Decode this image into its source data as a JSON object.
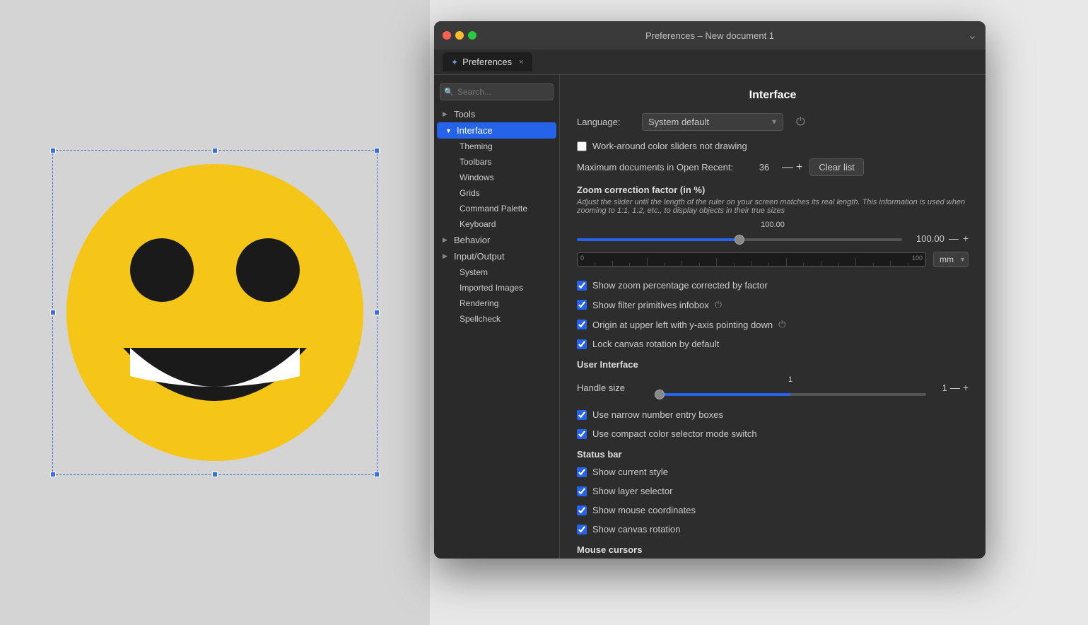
{
  "canvas": {
    "background": "#d4d4d4"
  },
  "window": {
    "title": "Preferences – New document 1",
    "tab_label": "Preferences",
    "tab_close": "×",
    "chevron": "⌄"
  },
  "search": {
    "placeholder": "Search..."
  },
  "sidebar": {
    "items": [
      {
        "id": "tools",
        "label": "Tools",
        "hasArrow": true,
        "arrow": "▶",
        "indent": 0
      },
      {
        "id": "interface",
        "label": "Interface",
        "hasArrow": true,
        "arrow": "▼",
        "indent": 0,
        "active": true
      },
      {
        "id": "theming",
        "label": "Theming",
        "hasArrow": false,
        "arrow": "",
        "indent": 1
      },
      {
        "id": "toolbars",
        "label": "Toolbars",
        "hasArrow": false,
        "arrow": "",
        "indent": 1
      },
      {
        "id": "windows",
        "label": "Windows",
        "hasArrow": false,
        "arrow": "",
        "indent": 1
      },
      {
        "id": "grids",
        "label": "Grids",
        "hasArrow": false,
        "arrow": "",
        "indent": 1
      },
      {
        "id": "command-palette",
        "label": "Command Palette",
        "hasArrow": false,
        "arrow": "",
        "indent": 1
      },
      {
        "id": "keyboard",
        "label": "Keyboard",
        "hasArrow": false,
        "arrow": "",
        "indent": 1
      },
      {
        "id": "behavior",
        "label": "Behavior",
        "hasArrow": true,
        "arrow": "▶",
        "indent": 0
      },
      {
        "id": "input-output",
        "label": "Input/Output",
        "hasArrow": true,
        "arrow": "▶",
        "indent": 0
      },
      {
        "id": "system",
        "label": "System",
        "hasArrow": false,
        "arrow": "",
        "indent": 1
      },
      {
        "id": "imported-images",
        "label": "Imported Images",
        "hasArrow": false,
        "arrow": "",
        "indent": 1
      },
      {
        "id": "rendering",
        "label": "Rendering",
        "hasArrow": false,
        "arrow": "",
        "indent": 1
      },
      {
        "id": "spellcheck",
        "label": "Spellcheck",
        "hasArrow": false,
        "arrow": "",
        "indent": 1
      }
    ]
  },
  "content": {
    "title": "Interface",
    "language_label": "Language:",
    "language_value": "System default",
    "workaround_label": "Work-around color sliders not drawing",
    "max_docs_label": "Maximum documents in Open Recent:",
    "max_docs_value": "36",
    "clear_list_label": "Clear list",
    "zoom_section_title": "Zoom correction factor (in %)",
    "zoom_desc": "Adjust the slider until the length of the ruler on your screen matches its real length. This information is used when zooming to 1:1, 1:2, etc., to display objects in their true sizes",
    "zoom_value_label": "100.00",
    "zoom_slider_value": 50,
    "ruler_left": "0",
    "ruler_right": "100",
    "unit_value": "mm",
    "show_zoom_pct_label": "Show zoom percentage corrected by factor",
    "show_filter_primitives_label": "Show filter primitives infobox",
    "origin_upper_left_label": "Origin at upper left with y-axis pointing down",
    "lock_canvas_label": "Lock canvas rotation by default",
    "user_interface_title": "User Interface",
    "handle_size_label": "Handle size",
    "handle_size_value": "1",
    "handle_slider_value": 0,
    "use_narrow_label": "Use narrow number entry boxes",
    "use_compact_label": "Use compact color selector mode switch",
    "status_bar_title": "Status bar",
    "show_current_style_label": "Show current style",
    "show_layer_selector_label": "Show layer selector",
    "show_mouse_coords_label": "Show mouse coordinates",
    "show_canvas_rotation_label": "Show canvas rotation",
    "mouse_cursors_title": "Mouse cursors"
  }
}
